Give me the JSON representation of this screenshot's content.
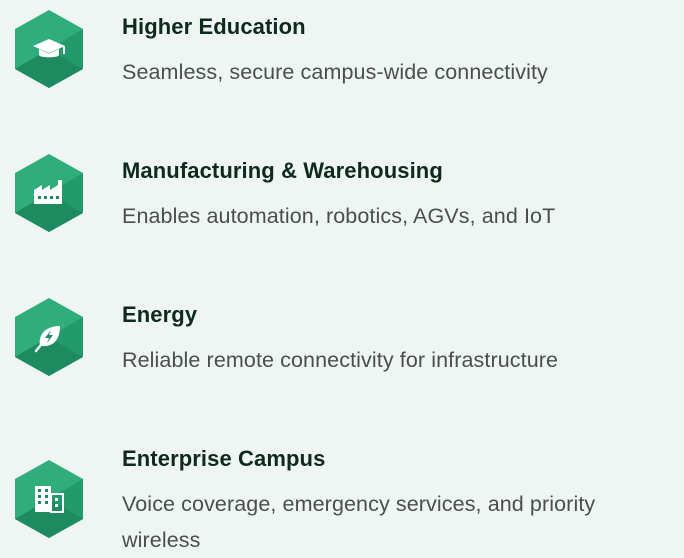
{
  "colors": {
    "hex_light": "#2fae7c",
    "hex_dark": "#1d8a60",
    "title": "#0e2a1c",
    "desc": "#4a4f4c",
    "background": "#eef5f2"
  },
  "items": [
    {
      "icon": "graduation-cap-icon",
      "title": "Higher Education",
      "description": "Seamless, secure campus-wide connectivity"
    },
    {
      "icon": "factory-icon",
      "title": "Manufacturing & Warehousing",
      "description": "Enables automation, robotics, AGVs, and IoT"
    },
    {
      "icon": "energy-leaf-icon",
      "title": "Energy",
      "description": "Reliable remote connectivity for infrastructure"
    },
    {
      "icon": "building-icon",
      "title": "Enterprise Campus",
      "description": "Voice coverage, emergency services, and priority wireless"
    }
  ]
}
